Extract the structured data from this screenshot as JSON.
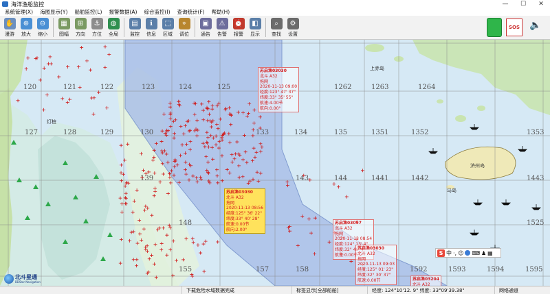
{
  "window": {
    "title": "海洋渔船监控",
    "controls": [
      "—",
      "☐",
      "✕"
    ]
  },
  "menu": [
    "系统管理(X)",
    "海图显示(Y)",
    "船舶监控(L)",
    "报警数据(A)",
    "综合监控(I)",
    "查询统计(F)",
    "帮助(H)"
  ],
  "toolbar": {
    "buttons": [
      {
        "label": "漫游",
        "icon": "pan-hand-icon"
      },
      {
        "label": "放大",
        "icon": "zoom-in-icon"
      },
      {
        "label": "缩小",
        "icon": "zoom-out-icon"
      },
      {
        "label": "图幅",
        "icon": "map-sheet-icon"
      },
      {
        "label": "方向",
        "icon": "compass-icon"
      },
      {
        "label": "方位",
        "icon": "anchor-icon"
      },
      {
        "label": "全局",
        "icon": "globe-icon"
      },
      {
        "label": "监控",
        "icon": "monitor-icon"
      },
      {
        "label": "信息",
        "icon": "info-icon"
      },
      {
        "label": "区域",
        "icon": "region-icon"
      },
      {
        "label": "调位",
        "icon": "position-icon"
      },
      {
        "label": "通告",
        "icon": "notice-icon"
      },
      {
        "label": "告警",
        "icon": "alert-icon"
      },
      {
        "label": "报警",
        "icon": "alarm-icon"
      },
      {
        "label": "显示",
        "icon": "display-icon"
      },
      {
        "label": "查找",
        "icon": "search-icon"
      },
      {
        "label": "设置",
        "icon": "gear-icon"
      }
    ],
    "sos_label": "SOS"
  },
  "map": {
    "grid_labels": [
      {
        "text": "120"
      },
      {
        "text": "121"
      },
      {
        "text": "122"
      },
      {
        "text": "123"
      },
      {
        "text": "124"
      },
      {
        "text": "125"
      },
      {
        "text": "1262"
      },
      {
        "text": "1263"
      },
      {
        "text": "1264"
      },
      {
        "text": "127"
      },
      {
        "text": "128"
      },
      {
        "text": "129"
      },
      {
        "text": "130"
      },
      {
        "text": "133"
      },
      {
        "text": "134"
      },
      {
        "text": "135"
      },
      {
        "text": "1351"
      },
      {
        "text": "1352"
      },
      {
        "text": "1353"
      },
      {
        "text": "139"
      },
      {
        "text": "143"
      },
      {
        "text": "144"
      },
      {
        "text": "1441"
      },
      {
        "text": "1442"
      },
      {
        "text": "1443"
      },
      {
        "text": "148"
      },
      {
        "text": "1525"
      },
      {
        "text": "155"
      },
      {
        "text": "157"
      },
      {
        "text": "158"
      },
      {
        "text": "1592"
      },
      {
        "text": "1593"
      },
      {
        "text": "1594"
      },
      {
        "text": "1595"
      }
    ],
    "place_labels": [
      "济州岛",
      "马岛",
      "上赤岛",
      "灯桩",
      "北斗星通"
    ],
    "popups": [
      {
        "lines": [
          "苏启渔03030",
          "北斗 A32",
          "拖网",
          "2020-11-13 09:00",
          "经度:123° 47' 37\"",
          "纬度:33° 35' 55\"",
          "航速:4.00节",
          "航向:0.00°"
        ],
        "selected": false
      },
      {
        "lines": [
          "苏启渔03030",
          "北斗 A32",
          "拖网",
          "2020-11-13 08:56",
          "经度:125° 36' 22\"",
          "纬度:33° 40' 28\"",
          "航速:0.00节",
          "航向:2.00°"
        ],
        "selected": true
      },
      {
        "lines": [
          "苏启渔03097",
          "北斗 A32",
          "拖网",
          "2020-11-13 08:54",
          "经度:124° 13' 4\"",
          "纬度:32° 46' 4\"",
          "航速:0.00节"
        ],
        "selected": false
      },
      {
        "lines": [
          "苏启渔03030",
          "北斗 A32",
          "拖网",
          "2020-11-13 09:03",
          "经度:125° 01' 23\"",
          "纬度:32° 30' 37\"",
          "航速:0.00节"
        ],
        "selected": false
      },
      {
        "lines": [
          "苏启渔03204",
          "北斗 A32"
        ],
        "selected": false
      }
    ]
  },
  "brand": {
    "name": "北斗星通",
    "sub": "BDStar Navigation"
  },
  "status": {
    "download": "下载危险水域数据完成",
    "display": "标签显示[全部船舶]",
    "coords": "经度: 124°10'12. 9\" 纬度: 33°09'39.38\"",
    "network": "网络通道"
  },
  "colors": {
    "sea": "#d6e9f5",
    "zone": "#a9bfe8",
    "land": "#c9e4b0",
    "shallow": "#cde4ea",
    "target": "#d01a1a"
  }
}
